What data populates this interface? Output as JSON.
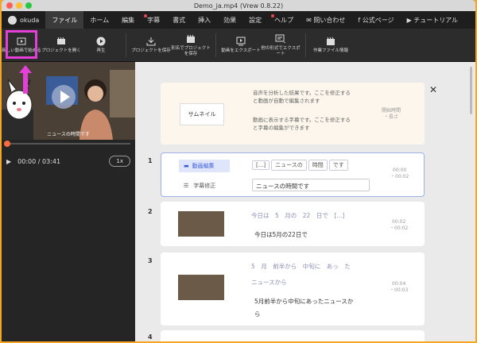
{
  "window": {
    "title": "Demo_ja.mp4 (Vrew 0.8.22)"
  },
  "menubar": {
    "user": "okuda",
    "items": [
      "ファイル",
      "ホーム",
      "編集",
      "字幕",
      "書式",
      "挿入",
      "効果",
      "設定",
      "ヘルプ"
    ],
    "active": "ファイル",
    "right_items": [
      "問い合わせ",
      "公式ページ",
      "チュートリアル"
    ]
  },
  "toolbar": {
    "new_video": "新しい動画で始める",
    "open_project": "プロジェクトを開く",
    "play": "再生",
    "save_project": "プロジェクトを保存",
    "save_as": "別名でプロジェクトを保存",
    "export_video": "動画をエクスポート",
    "export_other": "他の形式でエクスポート",
    "file_info": "作業ファイル情報"
  },
  "player": {
    "caption": "ニュースの時間です",
    "time": "00:00 / 03:41",
    "speed": "1x"
  },
  "info_card": {
    "thumb_label": "サムネイル",
    "text1a": "音声を分析した結果です。ここを修正する",
    "text1b": "と動画が自動で編集されます",
    "text2a": "動画に表示する字幕です。ここを修正する",
    "text2b": "と字幕の編集ができます",
    "meta1": "開始時間",
    "meta2": "・長さ"
  },
  "clips": [
    {
      "num": "1",
      "tab_video": "動画編集",
      "tab_sub": "字幕修正",
      "chips": [
        "[...]",
        "ニュースの",
        "時間",
        "です"
      ],
      "subtitle": "ニュースの時間です",
      "start": "00:00",
      "length": "・00:02"
    },
    {
      "num": "2",
      "words": "今日は　5　月の　22　日で　[...]",
      "subtitle": "今日は5月の22日で",
      "start": "00:02",
      "length": "・00:02"
    },
    {
      "num": "3",
      "words1": "5　月　前半から　中旬に　あっ　た",
      "words2": "ニュースから",
      "subtitle1": "5月前半から中旬にあったニュースか",
      "subtitle2": "ら",
      "start": "00:04",
      "length": "・00:03"
    },
    {
      "num": "4"
    }
  ]
}
